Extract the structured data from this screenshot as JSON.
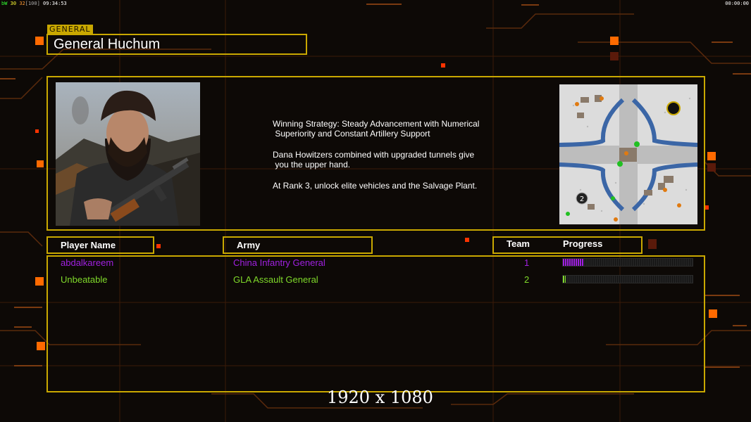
{
  "hud": {
    "bw": "bW",
    "fps": "30",
    "val": "32",
    "br": "[100]",
    "clock": "09:34:53",
    "timer": "00:00:00"
  },
  "general": {
    "tag": "GENERAL",
    "name": "General Huchum",
    "strategy_l1": "Winning Strategy: Steady Advancement with Numerical",
    "strategy_l2": "Superiority and Constant Artillery Support",
    "tip1_l1": "Dana Howitzers combined with upgraded tunnels give",
    "tip1_l2": "you the upper hand.",
    "tip2": "At Rank 3, unlock elite vehicles and the Salvage Plant."
  },
  "table": {
    "headers": {
      "player": "Player Name",
      "army": "Army",
      "team": "Team",
      "progress": "Progress"
    },
    "rows": [
      {
        "player": "abdalkareem",
        "army": "China Infantry General",
        "team": "1",
        "progress": 0.16,
        "color": "#a020e0"
      },
      {
        "player": "Unbeatable",
        "army": "GLA Assault General",
        "team": "2",
        "progress": 0.02,
        "color": "#7fd92a"
      }
    ]
  },
  "minimap": {
    "player_marker": "2"
  },
  "footer": {
    "resolution": "1920 x 1080"
  },
  "colors": {
    "accent": "#c9a800",
    "glow": "#ff6a00"
  }
}
